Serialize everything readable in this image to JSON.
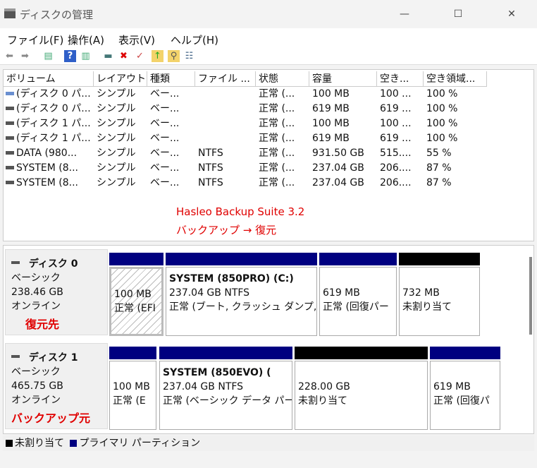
{
  "window": {
    "title": "ディスクの管理",
    "minimize": "—",
    "maximize": "☐",
    "close": "✕"
  },
  "menu": [
    "ファイル(F)",
    "操作(A)",
    "表示(V)",
    "ヘルプ(H)"
  ],
  "columns": [
    "ボリューム",
    "レイアウト",
    "種類",
    "ファイル ...",
    "状態",
    "容量",
    "空き...",
    "空き領域..."
  ],
  "rows": [
    [
      "(ディスク 0 パ...",
      "シンプル",
      "ベー...",
      "",
      "正常 (...",
      "100 MB",
      "100 ...",
      "100 %"
    ],
    [
      "(ディスク 0 パ...",
      "シンプル",
      "ベー...",
      "",
      "正常 (...",
      "619 MB",
      "619 ...",
      "100 %"
    ],
    [
      "(ディスク 1 パ...",
      "シンプル",
      "ベー...",
      "",
      "正常 (...",
      "100 MB",
      "100 ...",
      "100 %"
    ],
    [
      "(ディスク 1 パ...",
      "シンプル",
      "ベー...",
      "",
      "正常 (...",
      "619 MB",
      "619 ...",
      "100 %"
    ],
    [
      "DATA (980...",
      "シンプル",
      "ベー...",
      "NTFS",
      "正常 (...",
      "931.50 GB",
      "515....",
      "55 %"
    ],
    [
      "SYSTEM (8...",
      "シンプル",
      "ベー...",
      "NTFS",
      "正常 (...",
      "237.04 GB",
      "206....",
      "87 %"
    ],
    [
      "SYSTEM (8...",
      "シンプル",
      "ベー...",
      "NTFS",
      "正常 (...",
      "237.04 GB",
      "206....",
      "87 %"
    ]
  ],
  "annotation": {
    "line1": "Hasleo Backup Suite 3.2",
    "line2": "バックアップ → 復元"
  },
  "disks": [
    {
      "name": "ディスク 0",
      "type": "ベーシック",
      "size": "238.46 GB",
      "status": "オンライン",
      "note": "復元先",
      "parts": [
        {
          "title": "",
          "l1": "100 MB",
          "l2": "正常 (EFI",
          "kind": "primary"
        },
        {
          "title": "SYSTEM (850PRO)  (C:)",
          "l1": "237.04 GB NTFS",
          "l2": "正常 (ブート, クラッシュ ダンプ, ペ",
          "kind": "primary"
        },
        {
          "title": "",
          "l1": "619 MB",
          "l2": "正常 (回復パー",
          "kind": "primary"
        },
        {
          "title": "",
          "l1": "732 MB",
          "l2": "未割り当て",
          "kind": "unallocated"
        }
      ]
    },
    {
      "name": "ディスク 1",
      "type": "ベーシック",
      "size": "465.75 GB",
      "status": "オンライン",
      "note": "バックアップ元",
      "parts": [
        {
          "title": "",
          "l1": "100 MB",
          "l2": "正常 (E",
          "kind": "primary"
        },
        {
          "title": "SYSTEM (850EVO)  (",
          "l1": "237.04 GB NTFS",
          "l2": "正常 (ベーシック データ パー",
          "kind": "primary"
        },
        {
          "title": "",
          "l1": "228.00 GB",
          "l2": "未割り当て",
          "kind": "unallocated"
        },
        {
          "title": "",
          "l1": "619 MB",
          "l2": "正常 (回復パ",
          "kind": "primary"
        }
      ]
    }
  ],
  "legend": {
    "unallocated": "未割り当て",
    "primary": "プライマリ パーティション"
  },
  "colors": {
    "primary": "#000080",
    "unallocated": "#000000",
    "note": "#e00000"
  }
}
